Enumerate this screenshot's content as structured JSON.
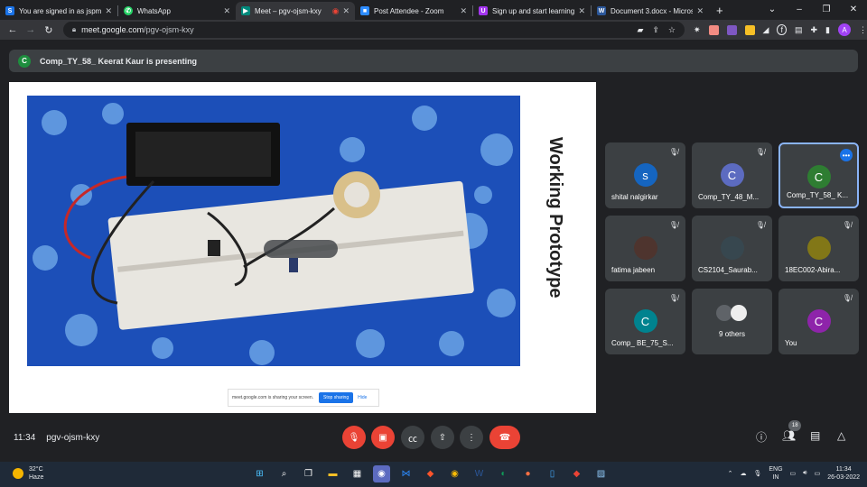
{
  "browser": {
    "tabs": [
      {
        "label": "You are signed in as jspm",
        "fav_color": "#1a73e8",
        "fav_glyph": "S"
      },
      {
        "label": "WhatsApp",
        "fav_color": "#25d366",
        "fav_glyph": "✆"
      },
      {
        "label": "Meet – pgv-ojsm-kxy",
        "fav_color": "#00897b",
        "fav_glyph": "▶"
      },
      {
        "label": "Post Attendee - Zoom",
        "fav_color": "#2d8cff",
        "fav_glyph": "■"
      },
      {
        "label": "Sign up and start learning |",
        "fav_color": "#a435f0",
        "fav_glyph": "U"
      },
      {
        "label": "Document 3.docx - Microsof",
        "fav_color": "#2b579a",
        "fav_glyph": "W"
      }
    ],
    "url_host": "meet.google.com",
    "url_path": "/pgv-ojsm-kxy",
    "profile_initial": "A"
  },
  "meet": {
    "presenting_initial": "C",
    "presenting_text": "Comp_TY_58_ Keerat Kaur is presenting",
    "slide_title": "Working Prototype",
    "share_banner": {
      "text": "meet.google.com is sharing your screen.",
      "stop_label": "Stop sharing",
      "hide_label": "Hide"
    },
    "participants": [
      {
        "name": "shital nalgirkar",
        "initial": "s",
        "color": "#1565c0"
      },
      {
        "name": "Comp_TY_48_M...",
        "initial": "C",
        "color": "#5c6bc0"
      },
      {
        "name": "Comp_TY_58_ K...",
        "initial": "C",
        "color": "#2e7d32"
      },
      {
        "name": "fatima jabeen",
        "initial": "",
        "color": "#4e342e"
      },
      {
        "name": "CS2104_Saurab...",
        "initial": "",
        "color": "#37474f"
      },
      {
        "name": "18EC002-Abira...",
        "initial": "",
        "color": "#827717"
      },
      {
        "name": "Comp_ BE_75_S...",
        "initial": "C",
        "color": "#00838f"
      },
      {
        "name": "9 others",
        "initial": "",
        "color": "#5f6368"
      },
      {
        "name": "You",
        "initial": "C",
        "color": "#8e24aa"
      }
    ],
    "time": "11:34",
    "meeting_code": "pgv-ojsm-kxy",
    "people_count": "18"
  },
  "taskbar": {
    "temperature": "32°C",
    "weather": "Haze",
    "lang_top": "ENG",
    "lang_bottom": "IN",
    "time": "11:34",
    "date": "26-03-2022"
  }
}
